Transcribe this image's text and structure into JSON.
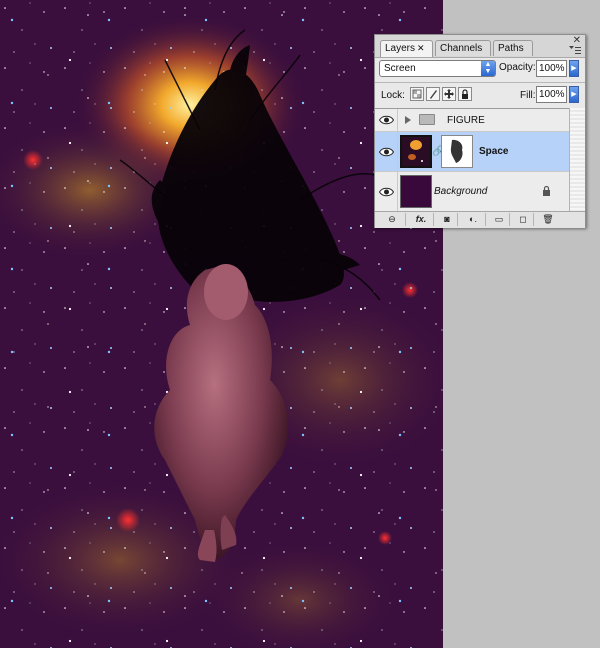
{
  "panel": {
    "tabs": [
      {
        "label": "Layers",
        "active": true
      },
      {
        "label": "Channels",
        "active": false
      },
      {
        "label": "Paths",
        "active": false
      }
    ],
    "close_glyph": "✕",
    "blend_mode": "Screen",
    "opacity_label": "Opacity:",
    "opacity_value": "100%",
    "lock_label": "Lock:",
    "fill_label": "Fill:",
    "fill_value": "100%",
    "layers": [
      {
        "name": "FIGURE",
        "type": "group",
        "visible": true,
        "selected": false
      },
      {
        "name": "Space",
        "type": "layer",
        "visible": true,
        "selected": true,
        "has_mask": true
      },
      {
        "name": "Background",
        "type": "background",
        "visible": true,
        "selected": false,
        "locked": true
      }
    ],
    "footer_buttons": [
      {
        "icon": "link-layers-icon",
        "glyph": "⊖"
      },
      {
        "icon": "layer-style-icon",
        "glyph": "fx."
      },
      {
        "icon": "add-mask-icon",
        "glyph": "◙"
      },
      {
        "icon": "adjustment-layer-icon",
        "glyph": "◐."
      },
      {
        "icon": "new-group-icon",
        "glyph": "▭"
      },
      {
        "icon": "new-layer-icon",
        "glyph": "◻"
      },
      {
        "icon": "trash-icon",
        "glyph": "🗑"
      }
    ],
    "colors": {
      "selection": "#b6d2f9",
      "accent_blue": "#2b67d1",
      "background_layer_fill": "#39093b"
    }
  }
}
